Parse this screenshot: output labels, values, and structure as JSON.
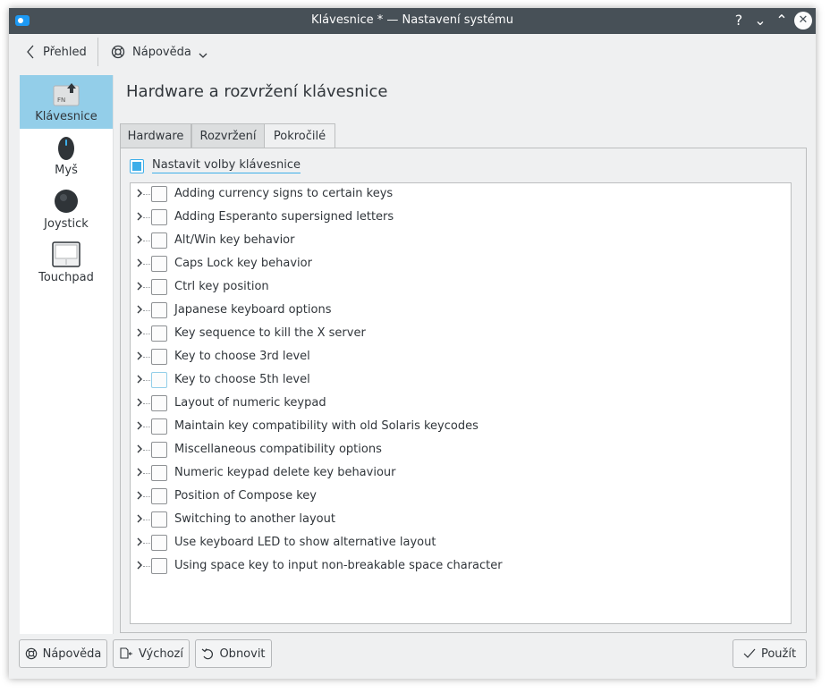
{
  "window": {
    "title": "Klávesnice * — Nastavení systému",
    "buttons": {
      "help": "?",
      "minimize": "⌄",
      "maximize": "⌃",
      "close": "✕"
    }
  },
  "toolbar": {
    "back_label": "Přehled",
    "help_label": "Nápověda"
  },
  "sidebar": {
    "items": [
      {
        "label": "Klávesnice",
        "icon": "keyboard-icon",
        "active": true
      },
      {
        "label": "Myš",
        "icon": "mouse-icon",
        "active": false
      },
      {
        "label": "Joystick",
        "icon": "joystick-icon",
        "active": false
      },
      {
        "label": "Touchpad",
        "icon": "touchpad-icon",
        "active": false
      }
    ]
  },
  "page": {
    "title": "Hardware a rozvržení klávesnice",
    "tabs": [
      {
        "label": "Hardware",
        "active": false
      },
      {
        "label": "Rozvržení",
        "active": false
      },
      {
        "label": "Pokročilé",
        "active": true
      }
    ],
    "configure_label": "Nastavit volby klávesnice",
    "configure_checked": true,
    "options": [
      "Adding currency signs to certain keys",
      "Adding Esperanto supersigned letters",
      "Alt/Win key behavior",
      "Caps Lock key behavior",
      "Ctrl key position",
      "Japanese keyboard options",
      "Key sequence to kill the X server",
      "Key to choose 3rd level",
      "Key to choose 5th level",
      "Layout of numeric keypad",
      "Maintain key compatibility with old Solaris keycodes",
      "Miscellaneous compatibility options",
      "Numeric keypad delete key behaviour",
      "Position of Compose key",
      "Switching to another layout",
      "Use keyboard LED to show alternative layout",
      "Using space key to input non-breakable space character"
    ],
    "focused_option_index": 8
  },
  "footer": {
    "help_label": "Nápověda",
    "defaults_label": "Výchozí",
    "reset_label": "Obnovit",
    "apply_label": "Použít"
  },
  "colors": {
    "accent": "#3daee9",
    "selection": "#93cee9",
    "titlebar": "#475057",
    "window_bg": "#eff0f1"
  }
}
